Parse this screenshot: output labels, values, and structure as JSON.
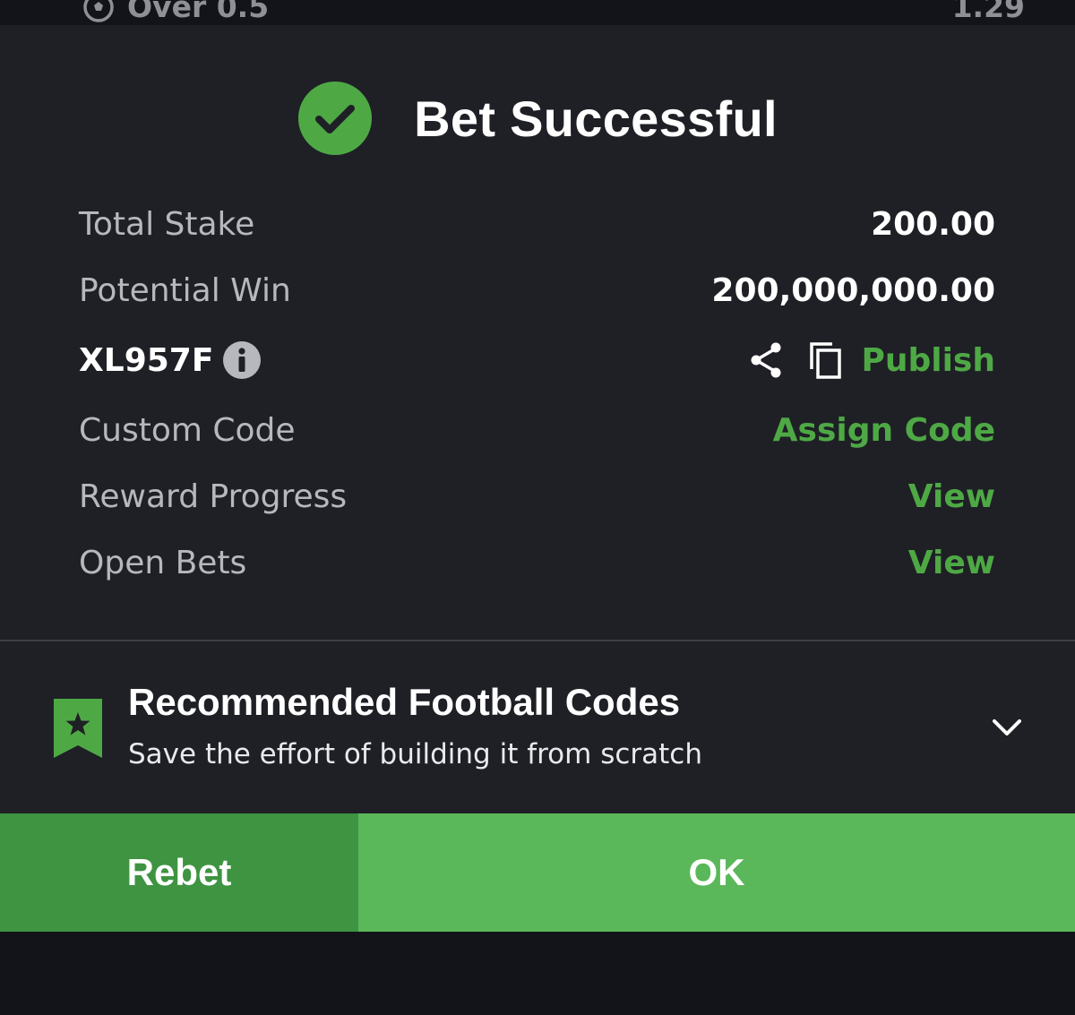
{
  "background_bet": {
    "selection": "Over 0.5",
    "odds": "1.29"
  },
  "modal": {
    "title": "Bet Successful",
    "rows": {
      "total_stake": {
        "label": "Total Stake",
        "value": "200.00"
      },
      "potential_win": {
        "label": "Potential Win",
        "value": "200,000,000.00"
      },
      "booking_code": {
        "code": "XL957F",
        "publish_label": "Publish"
      },
      "custom_code": {
        "label": "Custom Code",
        "action": "Assign Code"
      },
      "reward_progress": {
        "label": "Reward Progress",
        "action": "View"
      },
      "open_bets": {
        "label": "Open Bets",
        "action": "View"
      }
    },
    "recommended": {
      "title": "Recommended Football Codes",
      "subtitle": "Save the effort of building it from scratch"
    },
    "buttons": {
      "rebet": "Rebet",
      "ok": "OK"
    }
  },
  "colors": {
    "accent_green": "#4ea945",
    "ok_button": "#5bb85a",
    "rebet_button": "#3e9441",
    "modal_background": "#1f2026"
  },
  "icons": [
    "football-icon",
    "check-circle-icon",
    "info-icon",
    "share-icon",
    "copy-icon",
    "bookmark-star-icon",
    "chevron-down-icon"
  ]
}
